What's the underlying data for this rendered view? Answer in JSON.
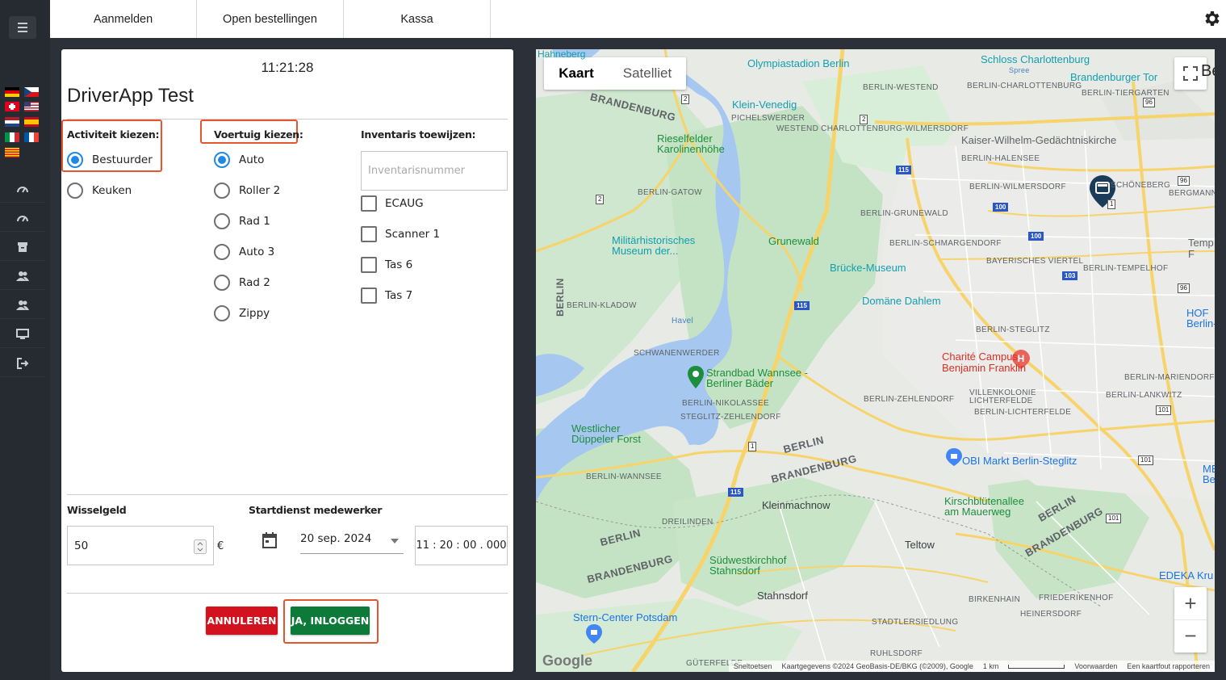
{
  "topbar": {
    "tabs": [
      "Aanmelden",
      "Open bestellingen",
      "Kassa"
    ]
  },
  "sidebar": {
    "flags": [
      "de",
      "cz",
      "ch",
      "us",
      "nl",
      "es",
      "it",
      "fr",
      "ca"
    ],
    "nav_icons": [
      "speedometer-icon",
      "speedometer-icon",
      "archive-icon",
      "users-icon",
      "users-icon",
      "monitor-icon",
      "logout-icon"
    ]
  },
  "panel": {
    "clock": "11:21:28",
    "title": "DriverApp Test",
    "activity": {
      "label": "Activiteit kiezen:",
      "options": [
        "Bestuurder",
        "Keuken"
      ],
      "selected": "Bestuurder"
    },
    "vehicle": {
      "label": "Voertuig kiezen:",
      "options": [
        "Auto",
        "Roller 2",
        "Rad 1",
        "Auto 3",
        "Rad 2",
        "Zippy"
      ],
      "selected": "Auto"
    },
    "inventory": {
      "label": "Inventaris toewijzen:",
      "placeholder": "Inventarisnummer",
      "items": [
        "ECAUG",
        "Scanner 1",
        "Tas 6",
        "Tas 7"
      ]
    },
    "change_money": {
      "label": "Wisselgeld",
      "value": "50",
      "currency": "€"
    },
    "start_shift": {
      "label": "Startdienst medewerker",
      "date": "20 sep. 2024",
      "time": "11 : 20 : 00 . 000"
    },
    "buttons": {
      "cancel": "ANNULEREN",
      "confirm": "JA, INLOGGEN"
    }
  },
  "map": {
    "type_buttons": [
      "Kaart",
      "Satelliet"
    ],
    "selected_type": "Kaart",
    "footer": {
      "logo": "Google",
      "shortcuts": "Sneltoetsen",
      "attribution": "Kaartgegevens ©2024 GeoBasis-DE/BKG (©2009), Google",
      "scale": "1 km",
      "terms": "Voorwaarden",
      "report": "Een kaartfout rapporteren"
    },
    "labels": {
      "olympiastadion": "Olympiastadion Berlin",
      "schloss": "Schloss Charlottenburg",
      "spree": "Spree",
      "brandenburger_tor": "Brandenburger Tor",
      "westend": "BERLIN-WESTEND",
      "charlottenburg": "BERLIN-CHARLOTTENBURG",
      "tiergarten": "BERLIN-TIERGARTEN",
      "brandenburg1": "BRANDENBURG",
      "klein_venedig": "Klein-Venedig",
      "pichelswerder": "PICHELSWERDER",
      "westend_wilm": "WESTEND CHARLOTTENBURG-WILMERSDORF",
      "rieselfelder": "Rieselfelder Karolinenhöhe",
      "kaiser": "Kaiser-Wilhelm-Gedächtniskirche",
      "halensee": "BERLIN-HALENSEE",
      "wilmersdorf": "BERLIN-WILMERSDORF",
      "schoneberg": "SCHÖNEBERG",
      "bergmann": "BERGMANN",
      "gatow": "BERLIN-GATOW",
      "grunewald_dist": "BERLIN-GRUNEWALD",
      "grunewald": "Grunewald",
      "schmargendorf": "BERLIN-SCHMARGENDORF",
      "militar": "Militärhistorisches Museum der...",
      "brucke": "Brücke-Museum",
      "tempelhof": "BERLIN-TEMPELHOF",
      "bayerisches": "BAYERISCHES VIERTEL",
      "domane": "Domäne Dahlem",
      "berlin_vert": "BERLIN",
      "kladow": "BERLIN-KLADOW",
      "havel": "Havel",
      "steglitz": "BERLIN-STEGLITZ",
      "schwanenwerder": "SCHWANENWERDER",
      "charite": "Charité Campus Benjamin Franklin",
      "strandbad": "Strandbad Wannsee - Berliner Bäder",
      "mariendorf": "BERLIN-MARIENDORF",
      "nikolassee": "BERLIN-NIKOLASSEE",
      "zehlendorf": "BERLIN-ZEHLENDORF",
      "villenkolonie": "VILLENKOLONIE LICHTERFELDE",
      "lankwitz": "BERLIN-LANKWITZ",
      "steglitz_zehl": "STEGLITZ-ZEHLENDORF",
      "lichterfelde": "BERLIN-LICHTERFELDE",
      "westlicher": "Westlicher Düppeler Forst",
      "berlin2": "BERLIN",
      "obi": "OBI Markt Berlin-Steglitz",
      "brandenburg2": "BRANDENBURG",
      "wannsee": "BERLIN-WANNSEE",
      "kirschbluten": "Kirschblütenallee am Mauerweg",
      "kleinmachnow": "Kleinmachnow",
      "dreilinden": "DREILINDEN",
      "berlin3": "BERLIN",
      "brandenburg3": "BRANDENBURG",
      "berlin4": "BERLIN",
      "brandenburg4": "BRANDENBURG",
      "teltow": "Teltow",
      "sudwest": "Südwestkirchhof Stahnsdorf",
      "brandenburg5": "BRANDENBURG",
      "stahnsdorf": "Stahnsdorf",
      "birkenhain": "BIRKENHAIN",
      "friedericken": "FRIEDERIKENHOF",
      "heinersdorf": "HEINERSDORF",
      "stern": "Stern-Center Potsdam",
      "stadtlers": "STADTLERSIEDLUNG",
      "ruhlsdorf": "RUHLSDORF",
      "guterfelde": "GÜTERFELDE",
      "edeka": "EDEKA Kru",
      "ho": "HOF Berlin-",
      "mb": "MB Be",
      "hahneberg": "Hahneberg",
      "berlin_top": "Be",
      "temp_right": "Temp F"
    }
  }
}
